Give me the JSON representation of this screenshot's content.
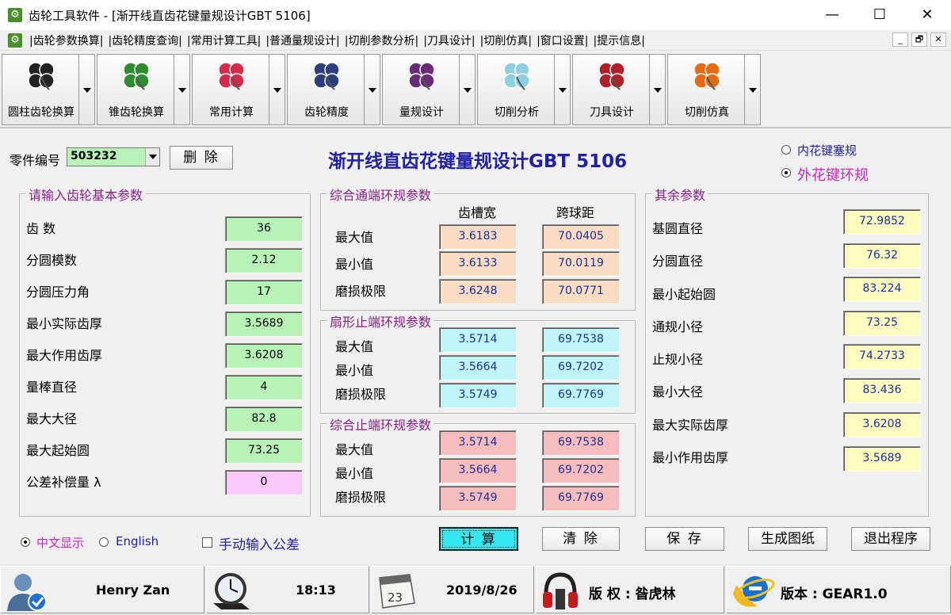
{
  "window": {
    "title": "齿轮工具软件 - [渐开线直齿花键量规设计GBT 5106]",
    "minimize": "—",
    "maximize": "☐",
    "close": "✕"
  },
  "menu": {
    "items": [
      "|齿轮参数换算|",
      "|齿轮精度查询|",
      "|常用计算工具|",
      "|普通量规设计|",
      "|切削参数分析|",
      "|刀具设计|",
      "|切削仿真|",
      "|窗口设置|",
      "|提示信息|"
    ],
    "mdi": [
      "_",
      "🗗",
      "✕"
    ]
  },
  "toolbar": {
    "tools": [
      {
        "label": "圆柱齿轮换算",
        "icon": "clover-black-icon",
        "color": "#222222"
      },
      {
        "label": "锥齿轮换算",
        "icon": "clover-green-icon",
        "color": "#2e8b2e"
      },
      {
        "label": "常用计算",
        "icon": "clover-red-icon",
        "color": "#d62a4a"
      },
      {
        "label": "齿轮精度",
        "icon": "clover-navy-icon",
        "color": "#2b3f7a"
      },
      {
        "label": "量规设计",
        "icon": "clover-purple-icon",
        "color": "#6a2a7a"
      },
      {
        "label": "切削分析",
        "icon": "clover-lightblue-icon",
        "color": "#8fcfe0"
      },
      {
        "label": "刀具设计",
        "icon": "clover-redblack-icon",
        "color": "#b0202a"
      },
      {
        "label": "切削仿真",
        "icon": "clover-orange-icon",
        "color": "#e86a10"
      }
    ]
  },
  "header": {
    "part_label": "零件编号",
    "part_value": "503232",
    "delete": "删 除",
    "title": "渐开线直齿花键量规设计GBT 5106",
    "radio_internal": "内花键塞规",
    "radio_external": "外花键环规"
  },
  "basic": {
    "title": "请输入齿轮基本参数",
    "rows": [
      {
        "label": "齿 数",
        "value": "36"
      },
      {
        "label": "分圆模数",
        "value": "2.12"
      },
      {
        "label": "分圆压力角",
        "value": "17"
      },
      {
        "label": "最小实际齿厚",
        "value": "3.5689"
      },
      {
        "label": "最大作用齿厚",
        "value": "3.6208"
      },
      {
        "label": "量棒直径",
        "value": "4"
      },
      {
        "label": "最大大径",
        "value": "82.8"
      },
      {
        "label": "最大起始圆",
        "value": "73.25"
      },
      {
        "label": "公差补偿量 λ",
        "value": "0"
      }
    ]
  },
  "comp_go": {
    "title": "综合通端环规参数",
    "col1": "齿槽宽",
    "col2": "跨球距",
    "rows": [
      {
        "label": "最大值",
        "v1": "3.6183",
        "v2": "70.0405"
      },
      {
        "label": "最小值",
        "v1": "3.6133",
        "v2": "70.0119"
      },
      {
        "label": "磨损极限",
        "v1": "3.6248",
        "v2": "70.0771"
      }
    ]
  },
  "sector": {
    "title": "扇形止端环规参数",
    "rows": [
      {
        "label": "最大值",
        "v1": "3.5714",
        "v2": "69.7538"
      },
      {
        "label": "最小值",
        "v1": "3.5664",
        "v2": "69.7202"
      },
      {
        "label": "磨损极限",
        "v1": "3.5749",
        "v2": "69.7769"
      }
    ]
  },
  "comp_stop": {
    "title": "综合止端环规参数",
    "rows": [
      {
        "label": "最大值",
        "v1": "3.5714",
        "v2": "69.7538"
      },
      {
        "label": "最小值",
        "v1": "3.5664",
        "v2": "69.7202"
      },
      {
        "label": "磨损极限",
        "v1": "3.5749",
        "v2": "69.7769"
      }
    ]
  },
  "other": {
    "title": "其余参数",
    "rows": [
      {
        "label": "基圆直径",
        "value": "72.9852"
      },
      {
        "label": "分圆直径",
        "value": "76.32"
      },
      {
        "label": "最小起始圆",
        "value": "83.224"
      },
      {
        "label": "通规小径",
        "value": "73.25"
      },
      {
        "label": "止规小径",
        "value": "74.2733"
      },
      {
        "label": "最小大径",
        "value": "83.436"
      },
      {
        "label": "最大实际齿厚",
        "value": "3.6208"
      },
      {
        "label": "最小作用齿厚",
        "value": "3.5689"
      }
    ]
  },
  "options": {
    "chinese": "中文显示",
    "english": "English",
    "manual": "手动输入公差"
  },
  "actions": {
    "calc": "计 算",
    "clear": "清 除",
    "save": "保 存",
    "drawing": "生成图纸",
    "exit": "退出程序"
  },
  "status": {
    "user": "Henry Zan",
    "time": "18:13",
    "calendar_day": "23",
    "date": "2019/8/26",
    "copyright": "版 权 : 昝虎林",
    "version": "版本 : GEAR1.0"
  },
  "colors": {
    "title_blue": "#1f1fa8",
    "group_title": "#8a1e8a",
    "value_blue": "#1b2e9c",
    "calc_button": "#33e8f0"
  }
}
